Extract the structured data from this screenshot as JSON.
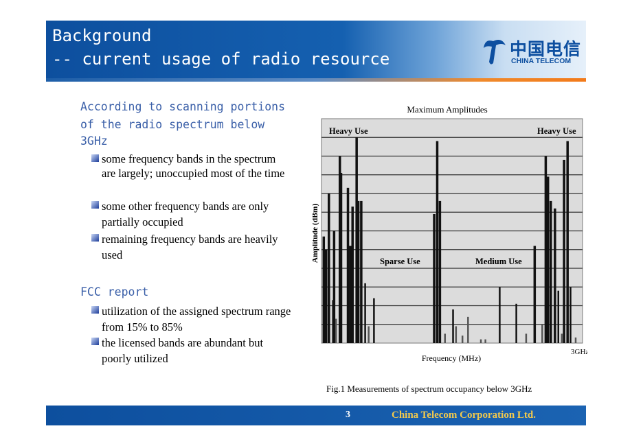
{
  "header": {
    "title_line1": "Background",
    "title_line2": "-- current usage of radio resource",
    "logo_cn": "中国电信",
    "logo_en": "CHINA TELECOM"
  },
  "content": {
    "section1": {
      "heading": [
        "According to scanning portions",
        "of the radio spectrum below",
        "3GHz"
      ],
      "bullets": [
        "some frequency bands in the spectrum are largely; unoccupied most of the time",
        "some other frequency bands are only partially occupied",
        "remaining frequency bands are heavily used"
      ]
    },
    "section2": {
      "heading": "FCC report",
      "bullets": [
        "utilization of the assigned spectrum range from 15% to 85%",
        "the licensed bands are abundant but poorly utilized"
      ]
    }
  },
  "figure": {
    "caption": "Fig.1   Measurements of spectrum occupancy below 3GHz"
  },
  "chart_data": {
    "type": "bar",
    "title": "Maximum Amplitudes",
    "xlabel": "Frequency (MHz)",
    "ylabel": "Amplitude (dBm)",
    "x_end_label": "3GHz",
    "xlim": [
      0,
      3000
    ],
    "ylim": [
      0,
      12
    ],
    "grid": true,
    "annotations": [
      "Heavy Use",
      "Sparse Use",
      "Medium Use",
      "Heavy Use"
    ],
    "x": [
      26,
      53,
      85,
      132,
      145,
      167,
      211,
      225,
      304,
      330,
      357,
      404,
      423,
      457,
      502,
      542,
      603,
      1295,
      1330,
      1361,
      1419,
      1512,
      1546,
      1620,
      1684,
      1832,
      1884,
      2048,
      2239,
      2352,
      2450,
      2537,
      2577,
      2603,
      2635,
      2683,
      2722,
      2762,
      2788,
      2828,
      2862,
      2921
    ],
    "values": [
      5.7,
      5.0,
      8.0,
      2.3,
      6.0,
      1.3,
      10.0,
      9.1,
      8.3,
      5.2,
      7.3,
      11.0,
      7.6,
      7.6,
      3.2,
      0.9,
      2.4,
      6.9,
      10.8,
      7.6,
      0.5,
      1.8,
      0.9,
      0.4,
      1.4,
      0.2,
      0.2,
      3.0,
      2.1,
      0.5,
      5.2,
      1.0,
      10.0,
      8.9,
      7.6,
      7.2,
      2.8,
      0.5,
      9.8,
      10.8,
      3.0,
      0.3
    ]
  },
  "footer": {
    "page": "3",
    "company": "China Telecom Corporation Ltd."
  },
  "colors": {
    "header_blue": "#0d4f9e",
    "accent_orange": "#f27a1a",
    "heading_blue": "#3a5fa8",
    "footer_text": "#f2c94c"
  }
}
